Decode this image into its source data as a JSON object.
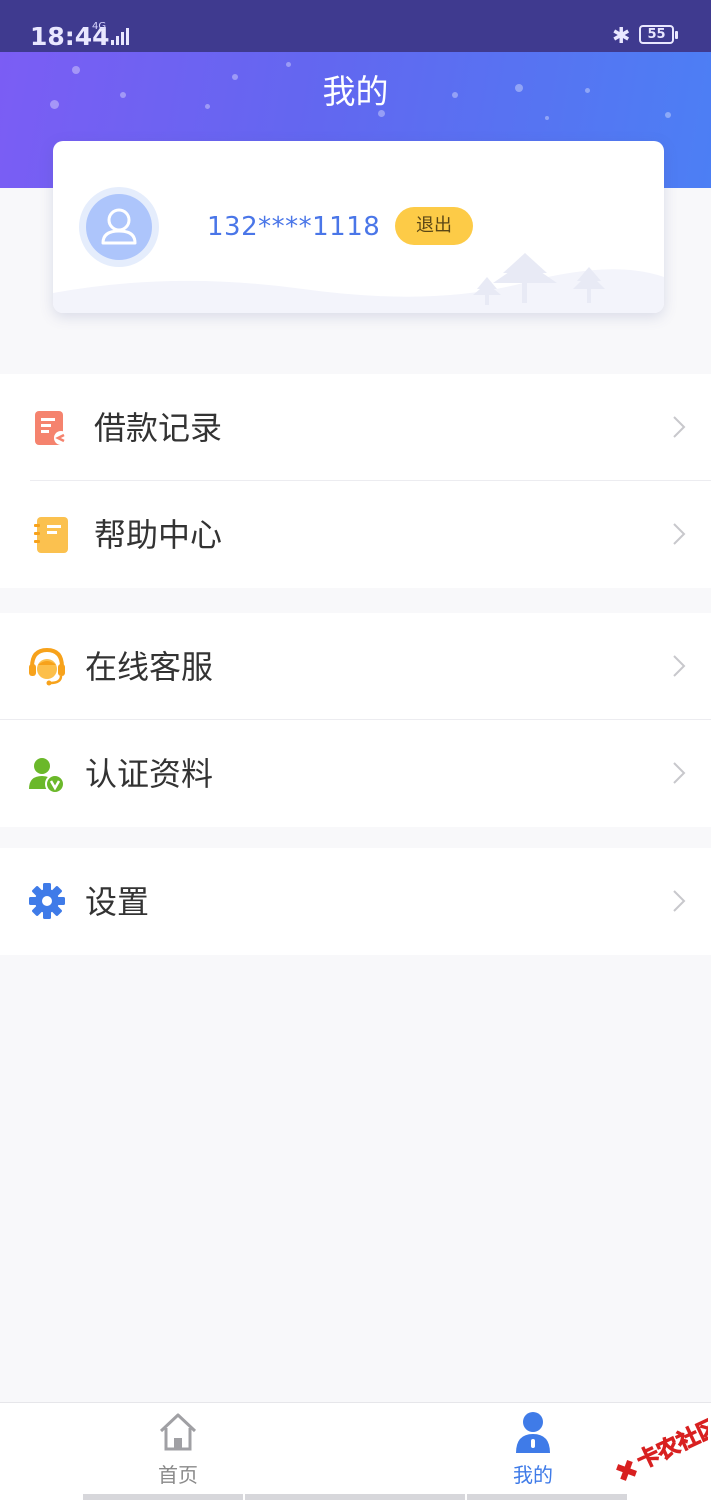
{
  "status_bar": {
    "time": "18:44",
    "network": "4G",
    "battery": "55"
  },
  "header": {
    "title": "我的"
  },
  "profile": {
    "phone": "132****1118",
    "logout_label": "退出"
  },
  "menu": {
    "group1": [
      {
        "label": "借款记录",
        "icon": "loan-record-icon",
        "color": "#f5836e"
      },
      {
        "label": "帮助中心",
        "icon": "help-book-icon",
        "color": "#fbc14f"
      }
    ],
    "group2": [
      {
        "label": "在线客服",
        "icon": "customer-service-icon",
        "color": "#f7a21b"
      },
      {
        "label": "认证资料",
        "icon": "verified-user-icon",
        "color": "#6bb82a"
      }
    ],
    "group3": [
      {
        "label": "设置",
        "icon": "gear-icon",
        "color": "#3f7be8"
      }
    ]
  },
  "tab_bar": {
    "home_label": "首页",
    "mine_label": "我的",
    "active_color": "#3f7be8",
    "inactive_color": "#8a8a8a"
  },
  "watermark": {
    "text": "卡农社区"
  }
}
